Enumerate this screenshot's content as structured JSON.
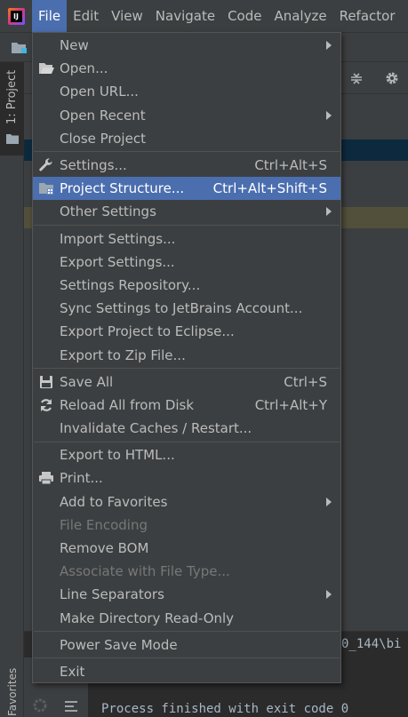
{
  "menubar": {
    "items": [
      "File",
      "Edit",
      "View",
      "Navigate",
      "Code",
      "Analyze",
      "Refactor"
    ]
  },
  "side": {
    "project_tab": "1: Project",
    "favorites_tab": "Favorites"
  },
  "background": {
    "path_fragment": "0_144\\bi",
    "console_line": "Process finished with exit code 0"
  },
  "file_menu": {
    "new": "New",
    "open": "Open...",
    "open_url": "Open URL...",
    "open_recent": "Open Recent",
    "close_project": "Close Project",
    "settings": "Settings...",
    "settings_sc": "Ctrl+Alt+S",
    "project_structure": "Project Structure...",
    "project_structure_sc": "Ctrl+Alt+Shift+S",
    "other_settings": "Other Settings",
    "import_settings": "Import Settings...",
    "export_settings": "Export Settings...",
    "settings_repository": "Settings Repository...",
    "sync_settings": "Sync Settings to JetBrains Account...",
    "export_eclipse": "Export Project to Eclipse...",
    "export_zip": "Export to Zip File...",
    "save_all": "Save All",
    "save_all_sc": "Ctrl+S",
    "reload_all": "Reload All from Disk",
    "reload_all_sc": "Ctrl+Alt+Y",
    "invalidate": "Invalidate Caches / Restart...",
    "export_html": "Export to HTML...",
    "print": "Print...",
    "add_favorites": "Add to Favorites",
    "file_encoding": "File Encoding",
    "remove_bom": "Remove BOM",
    "associate": "Associate with File Type...",
    "line_separators": "Line Separators",
    "make_readonly": "Make Directory Read-Only",
    "power_save": "Power Save Mode",
    "exit": "Exit"
  },
  "colors": {
    "highlight": "#4b6eaf",
    "menu_bg": "#3c3f41",
    "text": "#bbbbbb",
    "disabled": "#777777"
  }
}
